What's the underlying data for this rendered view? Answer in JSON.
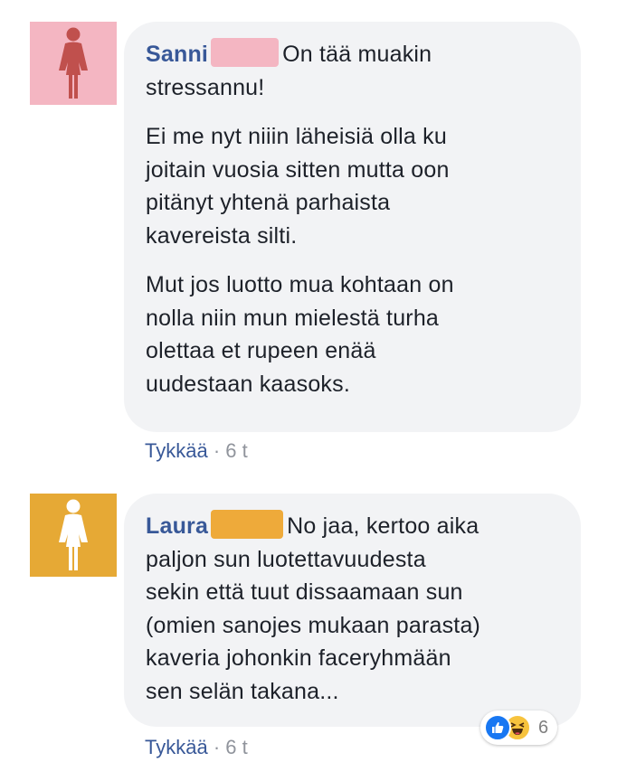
{
  "comments": [
    {
      "author": "Sanni",
      "redaction_color": "#f4b6c2",
      "avatar_bg": "#f4b6c2",
      "avatar_fg": "#c0504d",
      "avatar_icon": "female-person-icon",
      "first_text": "On tää muakin",
      "first_cont": "stressannu!",
      "para2": [
        "Ei me nyt niiin läheisiä olla ku",
        "joitain vuosia sitten mutta oon",
        "pitänyt yhtenä parhaista",
        "kavereista silti."
      ],
      "para3": [
        "Mut jos luotto mua kohtaan on",
        "nolla niin mun mielestä turha",
        "olettaa et rupeen enää",
        "uudestaan kaasoks."
      ],
      "like_label": "Tykkää",
      "separator": "·",
      "time": "6 t"
    },
    {
      "author": "Laura",
      "redaction_color": "#eeaa3a",
      "avatar_bg": "#e6a935",
      "avatar_fg": "#ffffff",
      "avatar_icon": "female-person-icon",
      "first_text": "No jaa, kertoo aika",
      "lines": [
        "paljon sun luotettavuudesta",
        "sekin että tuut dissaamaan sun",
        "(omien sanojes mukaan parasta)",
        "kaveria johonkin faceryhmään",
        "sen selän takana..."
      ],
      "like_label": "Tykkää",
      "separator": "·",
      "time": "6 t",
      "reactions": {
        "icons": [
          "like-icon",
          "haha-icon"
        ],
        "like_color": "#1877f2",
        "haha_color": "#f7c33d",
        "count": "6"
      }
    }
  ]
}
